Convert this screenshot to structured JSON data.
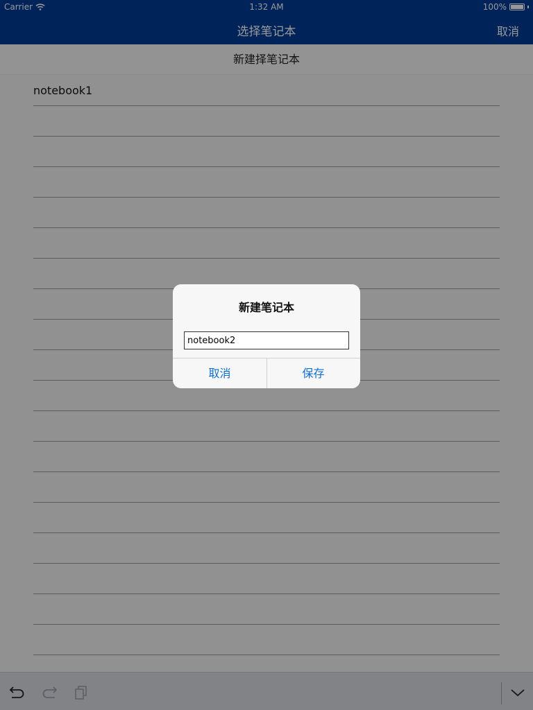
{
  "status_bar": {
    "carrier": "Carrier",
    "time": "1:32 AM",
    "battery": "100%"
  },
  "nav": {
    "title": "选择笔记本",
    "cancel_label": "取消"
  },
  "new_notebook_label": "新建择笔记本",
  "notebooks": [
    "notebook1",
    "",
    "",
    "",
    "",
    "",
    "",
    "",
    "",
    "",
    "",
    "",
    "",
    "",
    "",
    "",
    "",
    "",
    ""
  ],
  "dialog": {
    "title": "新建笔记本",
    "input_value": "notebook2",
    "cancel_label": "取消",
    "save_label": "保存"
  },
  "toolbar": {
    "icons": [
      "undo-icon",
      "redo-icon",
      "paste-icon",
      "chevron-down-icon"
    ]
  },
  "colors": {
    "nav_bar": "#003c96",
    "accent": "#0a6fd8"
  }
}
